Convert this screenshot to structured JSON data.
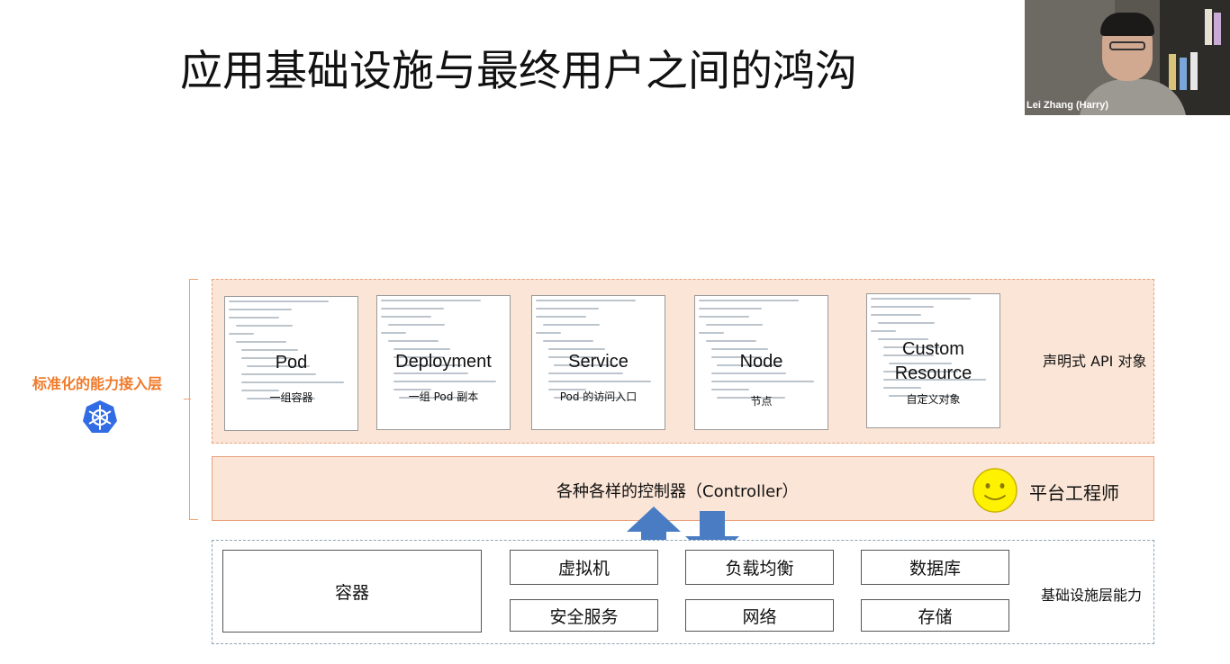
{
  "slide": {
    "title": "应用基础设施与最终用户之间的鸿沟"
  },
  "webcam": {
    "name": "Lei Zhang (Harry)"
  },
  "side": {
    "label": "标准化的能力接入层",
    "icon": "kubernetes-helm-icon",
    "accent_color": "#f07a2a"
  },
  "api_layer": {
    "label": "声明式 API 对象",
    "cards": [
      {
        "name": "Pod",
        "desc": "一组容器"
      },
      {
        "name": "Deployment",
        "desc": "一组 Pod  副本"
      },
      {
        "name": "Service",
        "desc": "Pod 的访问入口"
      },
      {
        "name": "Node",
        "desc": "节点"
      },
      {
        "name_line1": "Custom",
        "name_line2": "Resource",
        "desc": "自定义对象"
      }
    ]
  },
  "controller_layer": {
    "label": "各种各样的控制器（Controller）",
    "role": "平台工程师",
    "role_icon": "smiley-face-icon"
  },
  "infra_layer": {
    "label": "基础设施层能力",
    "items": {
      "container": "容器",
      "vm": "虚拟机",
      "lb": "负载均衡",
      "db": "数据库",
      "security": "安全服务",
      "network": "网络",
      "storage": "存储"
    }
  },
  "colors": {
    "layer_fill": "#fbe5d6",
    "layer_border": "#e8a27c",
    "arrow": "#4a7cc4",
    "smiley": "#fff200"
  }
}
